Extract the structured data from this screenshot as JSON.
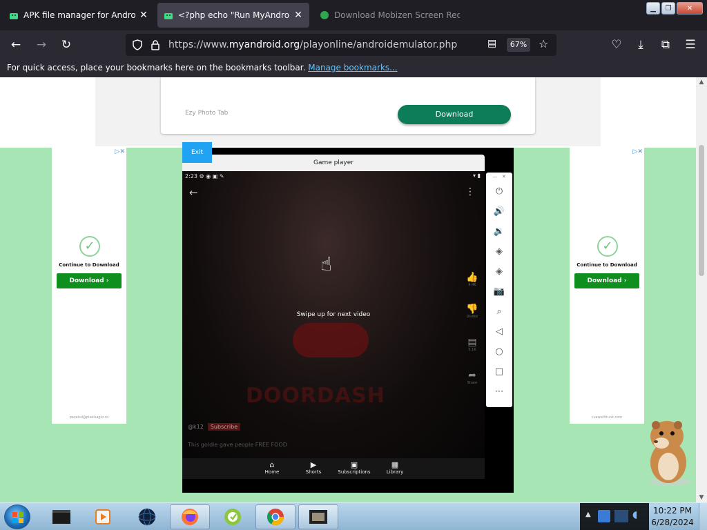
{
  "browser": {
    "tabs": [
      {
        "title": "APK file manager for Android a",
        "state": "inactive"
      },
      {
        "title": "<?php echo \"Run MyAndroid\";",
        "state": "active"
      },
      {
        "title": "Download Mobizen Screen Rec",
        "state": "faded"
      }
    ],
    "url_prefix": "https://www.",
    "url_domain": "myandroid.org",
    "url_path": "/playonline/androidemulator.php",
    "zoom": "67%",
    "bookmarks_text": "For quick access, place your bookmarks here on the bookmarks toolbar.",
    "bookmarks_link": "Manage bookmarks..."
  },
  "page": {
    "ad_top": {
      "app_name": "Ezy Photo Tab",
      "download_label": "Download"
    },
    "side_ad_left": {
      "continue": "Continue to Download",
      "download": "Download ›",
      "footer": "pexelsd@pixelsagio.co"
    },
    "side_ad_right": {
      "continue": "Continue to Download",
      "download": "Download ›",
      "footer": "cuewelltrunk.com"
    },
    "emulator": {
      "exit_label": "Exit",
      "title": "Game player",
      "status_time": "2:23",
      "swipe_hint": "Swipe up for next video",
      "brand_text": "DOORDASH",
      "channel": "@k12",
      "subscribe": "Subscribe",
      "caption": "This goldie gave people FREE FOOD",
      "rail": [
        {
          "icon": "like-icon",
          "label": "9.4K"
        },
        {
          "icon": "dislike-icon",
          "label": "Dislike"
        },
        {
          "icon": "comment-icon",
          "label": "5.1K"
        },
        {
          "icon": "share-icon",
          "label": "Share"
        }
      ],
      "nav": [
        {
          "icon": "home-icon",
          "label": "Home"
        },
        {
          "icon": "shorts-icon",
          "label": "Shorts"
        },
        {
          "icon": "subscriptions-icon",
          "label": "Subscriptions"
        },
        {
          "icon": "library-icon",
          "label": "Library"
        }
      ],
      "controls": [
        "power-icon",
        "volume-up-icon",
        "volume-down-icon",
        "rotate-left-icon",
        "rotate-right-icon",
        "camera-icon",
        "zoom-icon",
        "back-icon",
        "home-circle-icon",
        "overview-icon",
        "more-icon"
      ]
    }
  },
  "taskbar": {
    "apps": [
      "terminal-icon",
      "media-player-icon",
      "globe-icon",
      "firefox-icon",
      "greenshot-icon",
      "chrome-icon",
      "film-icon"
    ],
    "time": "10:22 PM",
    "date": "6/28/2024"
  },
  "colors": {
    "download_green": "#0c7c59",
    "ad_green": "#0e8f1e",
    "page_green": "#a7e6b4",
    "exit_blue": "#1fa3f2"
  }
}
